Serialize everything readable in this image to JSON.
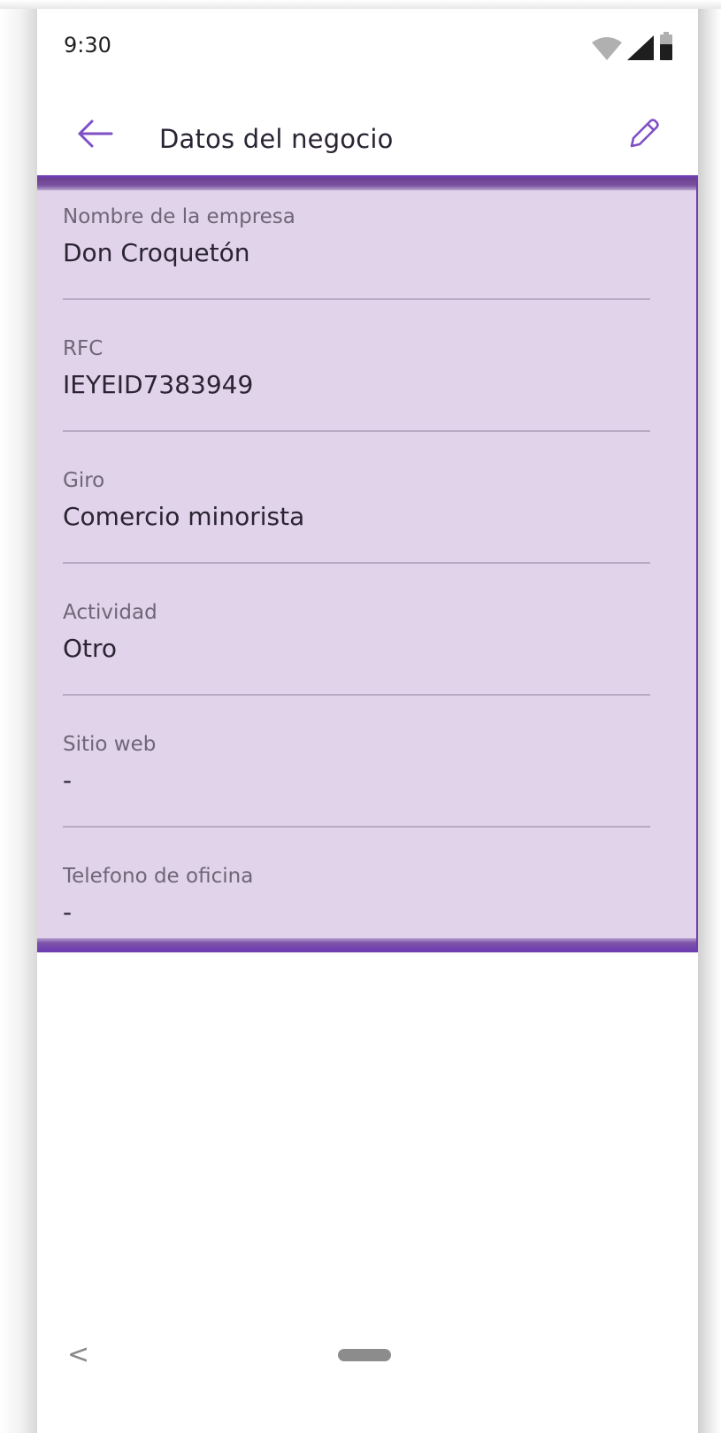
{
  "status_bar": {
    "time": "9:30",
    "icons": [
      "wifi-icon",
      "cell-signal-icon",
      "battery-icon"
    ]
  },
  "app_bar": {
    "back_icon": "arrow-left-icon",
    "title": "Datos del negocio",
    "edit_icon": "pencil-icon"
  },
  "details": {
    "fields": [
      {
        "label": "Nombre de la empresa",
        "value": "Don Croquetón"
      },
      {
        "label": "RFC",
        "value": "IEYEID7383949"
      },
      {
        "label": "Giro",
        "value": "Comercio minorista"
      },
      {
        "label": "Actividad",
        "value": "Otro"
      },
      {
        "label": "Sitio web",
        "value": "-"
      },
      {
        "label": "Telefono de oficina",
        "value": "-"
      }
    ]
  },
  "nav": {
    "back_glyph": "<",
    "home_icon": "home-pill-icon"
  },
  "colors": {
    "accent": "#7e4fc6",
    "highlight_fill": "#e1d3ea",
    "highlight_border": "#6f3fb0",
    "text_primary": "#2a2433",
    "text_label": "#6e6676"
  }
}
